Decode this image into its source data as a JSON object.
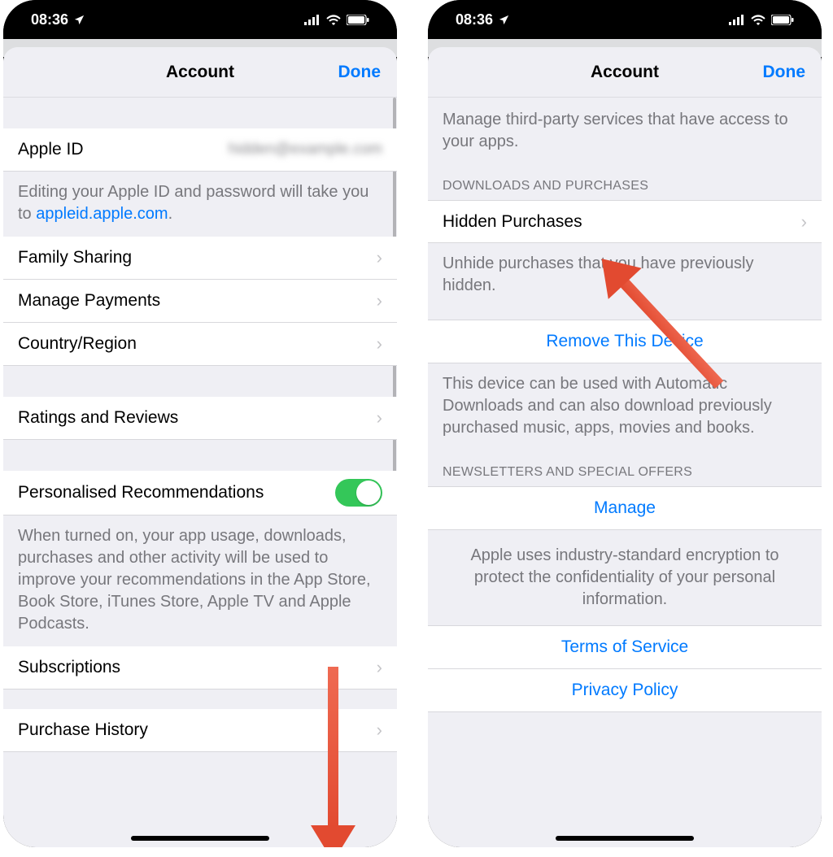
{
  "status": {
    "time": "08:36"
  },
  "header": {
    "title": "Account",
    "done": "Done"
  },
  "left": {
    "apple_id_label": "Apple ID",
    "apple_id_value": "hidden@example.com",
    "apple_id_help_pre": "Editing your Apple ID and password will take you to ",
    "apple_id_help_link": "appleid.apple.com",
    "apple_id_help_post": ".",
    "family_sharing": "Family Sharing",
    "manage_payments": "Manage Payments",
    "country_region": "Country/Region",
    "ratings_reviews": "Ratings and Reviews",
    "personalised": "Personalised Recommendations",
    "personalised_help": "When turned on, your app usage, downloads, purchases and other activity will be used to improve your recommendations in the App Store, Book Store, iTunes Store, Apple TV and Apple Podcasts.",
    "subscriptions": "Subscriptions",
    "purchase_history": "Purchase History"
  },
  "right": {
    "connected_help": "Manage third-party services that have access to your apps.",
    "downloads_header": "Downloads and Purchases",
    "hidden_purchases": "Hidden Purchases",
    "hidden_help": "Unhide purchases that you have previously hidden.",
    "remove_device": "Remove This Device",
    "remove_help": "This device can be used with Automatic Downloads and can also download previously purchased music, apps, movies and books.",
    "newsletters_header": "Newsletters and Special Offers",
    "manage": "Manage",
    "encryption": "Apple uses industry-standard encryption to protect the confidentiality of your personal information.",
    "terms": "Terms of Service",
    "privacy": "Privacy Policy"
  }
}
